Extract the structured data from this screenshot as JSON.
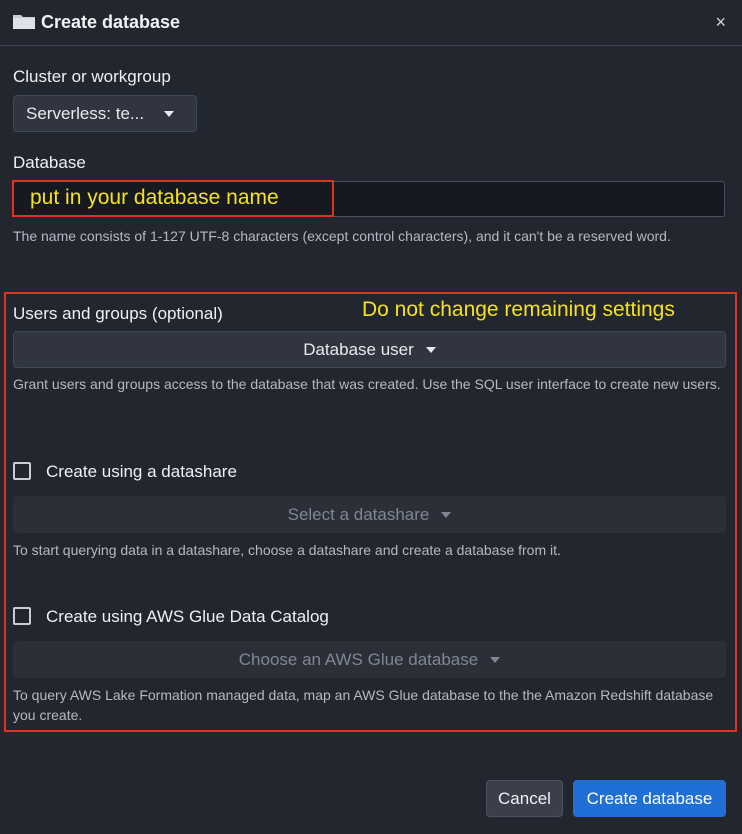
{
  "dialog": {
    "title": "Create database",
    "icons": {
      "folder": "folder-icon",
      "close": "close-icon"
    },
    "close_glyph": "×"
  },
  "cluster": {
    "label": "Cluster or workgroup",
    "selected": "Serverless: te..."
  },
  "database": {
    "label": "Database",
    "value": "",
    "help": "The name consists of 1-127 UTF-8 characters (except control characters), and it can't be a reserved word."
  },
  "users_groups": {
    "label": "Users and groups (optional)",
    "selected": "Database user",
    "help": "Grant users and groups access to the database that was created. Use the SQL user interface to create new users."
  },
  "datashare": {
    "checkbox_label": "Create using a datashare",
    "checked": false,
    "select_placeholder": "Select a datashare",
    "help": "To start querying data in a datashare, choose a datashare and create a database from it."
  },
  "glue": {
    "checkbox_label": "Create using AWS Glue Data Catalog",
    "checked": false,
    "select_placeholder": "Choose an AWS Glue database",
    "help": "To query AWS Lake Formation managed data, map an AWS Glue database to the the Amazon Redshift database you create."
  },
  "annotations": {
    "name_hint": "put in your database name",
    "settings_hint": "Do not change remaining settings",
    "color": "#e0321c",
    "text_color": "#f5e11c"
  },
  "footer": {
    "cancel_label": "Cancel",
    "create_label": "Create database",
    "primary_color": "#1f6fd6"
  }
}
